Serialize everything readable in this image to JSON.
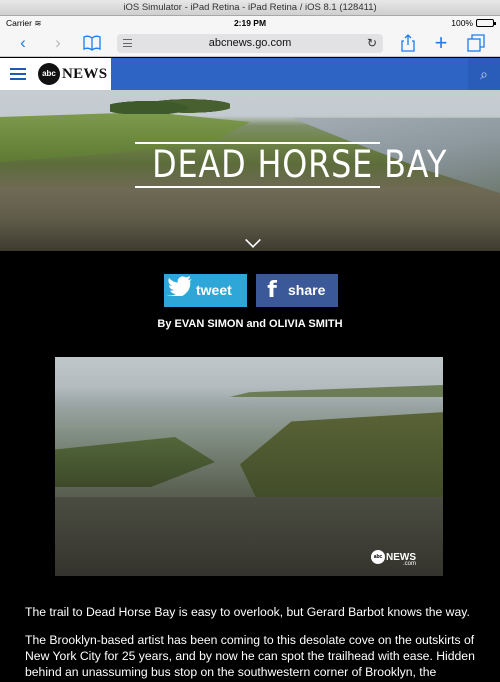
{
  "simulator": {
    "title": "iOS Simulator - iPad Retina - iPad Retina / iOS 8.1 (128411)"
  },
  "status_bar": {
    "carrier": "Carrier",
    "time": "2:19 PM",
    "battery": "100%",
    "battery_level": 1.0
  },
  "browser": {
    "url": "abcnews.go.com",
    "back_icon": "chevron-left-icon",
    "forward_icon": "chevron-right-icon",
    "bookmarks_icon": "book-icon",
    "share_icon": "share-icon",
    "new_tab_icon": "plus-icon",
    "tabs_icon": "tabs-icon"
  },
  "site_nav": {
    "logo_disc": "abc",
    "logo_text": "NEWS",
    "accent_color": "#2e64c4"
  },
  "hero": {
    "title": "DEAD HORSE BAY"
  },
  "share": {
    "tweet_label": "tweet",
    "share_label": "share",
    "twitter_color": "#2ea6d8",
    "facebook_color": "#3b5998"
  },
  "article": {
    "byline": "By EVAN SIMON and OLIVIA SMITH",
    "video_watermark": {
      "disc": "abc",
      "text": "NEWS",
      "suffix": ".com"
    },
    "paragraphs": [
      "The trail to Dead Horse Bay is easy to overlook, but Gerard Barbot knows the way.",
      "The Brooklyn-based artist has been coming to this desolate cove on the outskirts of New York City for 25 years, and by now he can spot the trailhead with ease. Hidden behind an unassuming bus stop on the southwestern corner of Brooklyn, the unmarked"
    ]
  }
}
